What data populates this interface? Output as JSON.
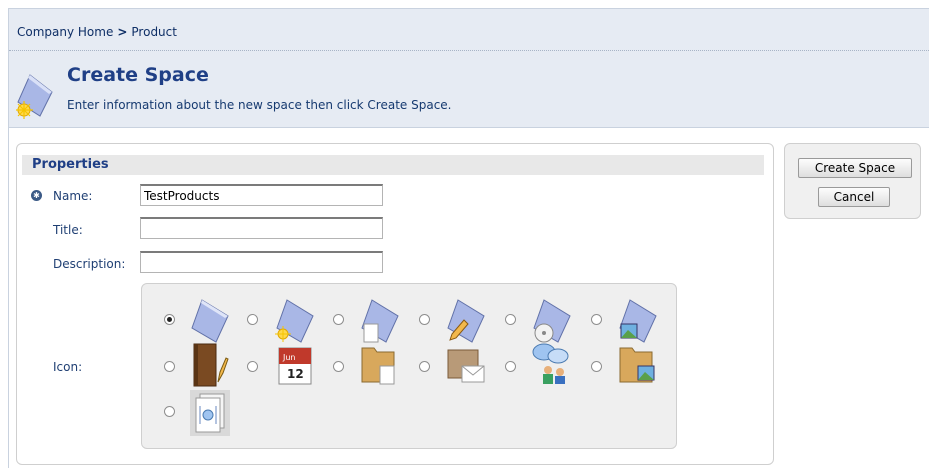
{
  "breadcrumb": {
    "items": [
      "Company Home",
      "Product"
    ],
    "separator": ">"
  },
  "header": {
    "title": "Create Space",
    "description": "Enter information about the new space then click Create Space.",
    "icon": "create-space-icon"
  },
  "properties": {
    "section_label": "Properties",
    "name_label": "Name:",
    "name_value": "TestProducts",
    "title_label": "Title:",
    "title_value": "",
    "description_label": "Description:",
    "description_value": "",
    "icon_label": "Icon:",
    "icons": [
      {
        "name": "space-icon",
        "selected": true
      },
      {
        "name": "space-new-icon",
        "selected": false
      },
      {
        "name": "space-document-icon",
        "selected": false
      },
      {
        "name": "space-edit-icon",
        "selected": false
      },
      {
        "name": "space-disc-icon",
        "selected": false
      },
      {
        "name": "space-image-icon",
        "selected": false
      },
      {
        "name": "notebook-pencil-icon",
        "selected": false
      },
      {
        "name": "calendar-icon",
        "selected": false
      },
      {
        "name": "folder-document-icon",
        "selected": false
      },
      {
        "name": "mail-box-icon",
        "selected": false
      },
      {
        "name": "discussion-people-icon",
        "selected": false
      },
      {
        "name": "folder-image-icon",
        "selected": false
      },
      {
        "name": "web-project-icon",
        "selected": false
      }
    ],
    "calendar_month": "Jun",
    "calendar_day": "12"
  },
  "actions": {
    "create_label": "Create Space",
    "cancel_label": "Cancel"
  },
  "colors": {
    "header_bg": "#e6ebf3",
    "title": "#1f3f86",
    "text": "#1f3f73"
  }
}
